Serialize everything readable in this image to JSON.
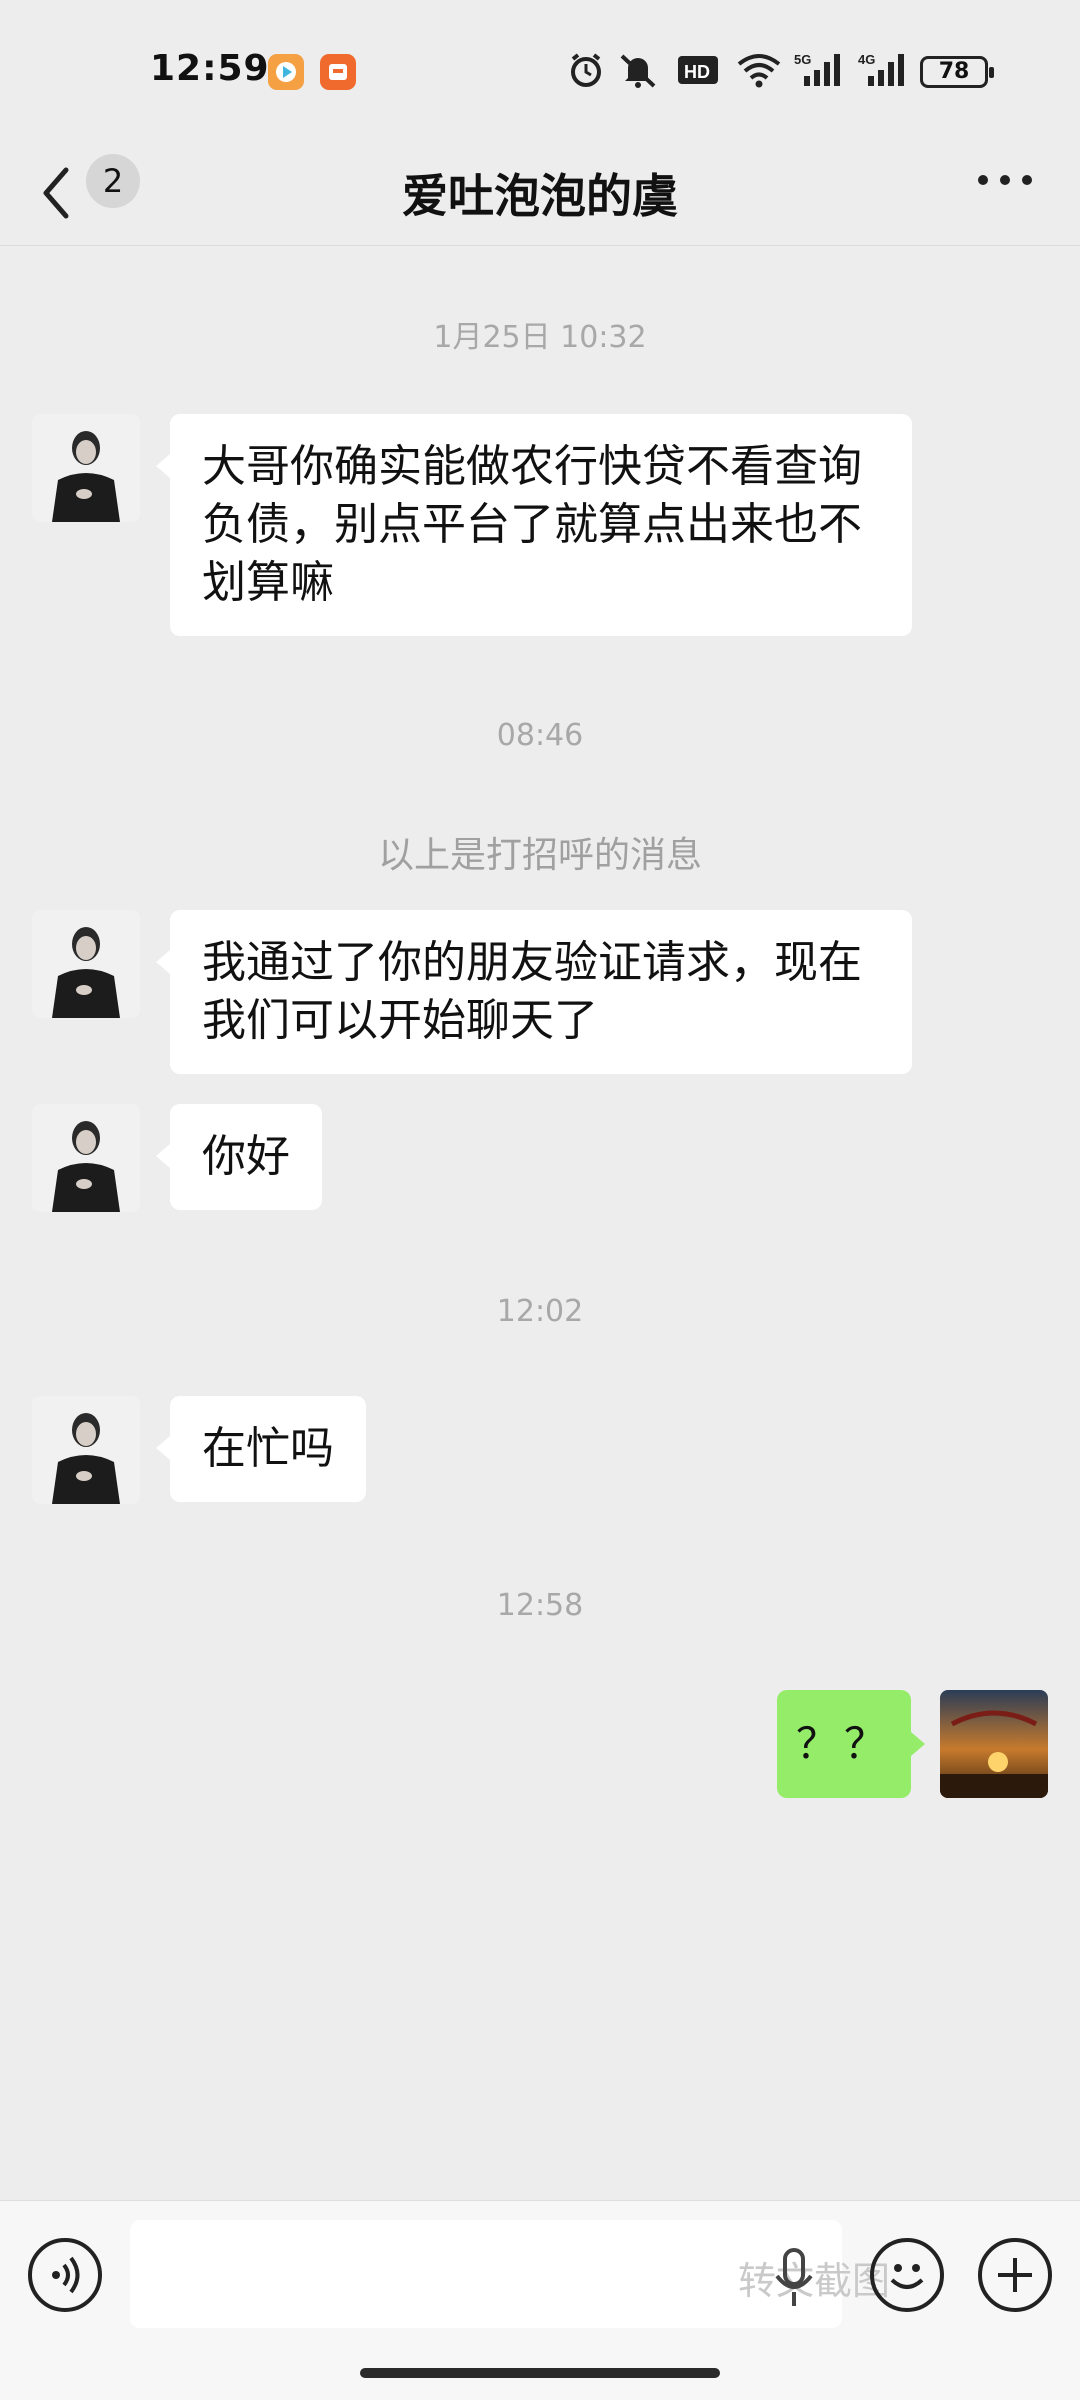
{
  "status_bar": {
    "time": "12:59",
    "battery": "78",
    "icons": [
      "video-app-icon",
      "orange-app-icon",
      "alarm-icon",
      "mute-icon",
      "hd-icon",
      "wifi-icon",
      "5g-signal-icon",
      "4g-signal-icon",
      "battery-icon"
    ]
  },
  "nav": {
    "back_badge": "2",
    "title": "爱吐泡泡的虞"
  },
  "chat": {
    "timestamps": [
      "1月25日 10:32",
      "08:46",
      "12:02",
      "12:58"
    ],
    "hint": "以上是打招呼的消息",
    "messages": [
      {
        "from": "other",
        "lines": [
          "大哥你确实能做农行快贷不看查询",
          "负债，别点平台了就算点出来也不",
          "划算嘛"
        ]
      },
      {
        "from": "other",
        "lines": [
          "我通过了你的朋友验证请求，现在",
          "我们可以开始聊天了"
        ]
      },
      {
        "from": "other",
        "lines": [
          "你好"
        ]
      },
      {
        "from": "other",
        "lines": [
          "在忙吗"
        ]
      },
      {
        "from": "me",
        "lines": [
          "？？"
        ]
      }
    ]
  },
  "input_bar": {
    "ghost_text": "转文截图"
  },
  "colors": {
    "background": "#ededed",
    "my_bubble": "#95ec69",
    "other_bubble": "#ffffff"
  }
}
